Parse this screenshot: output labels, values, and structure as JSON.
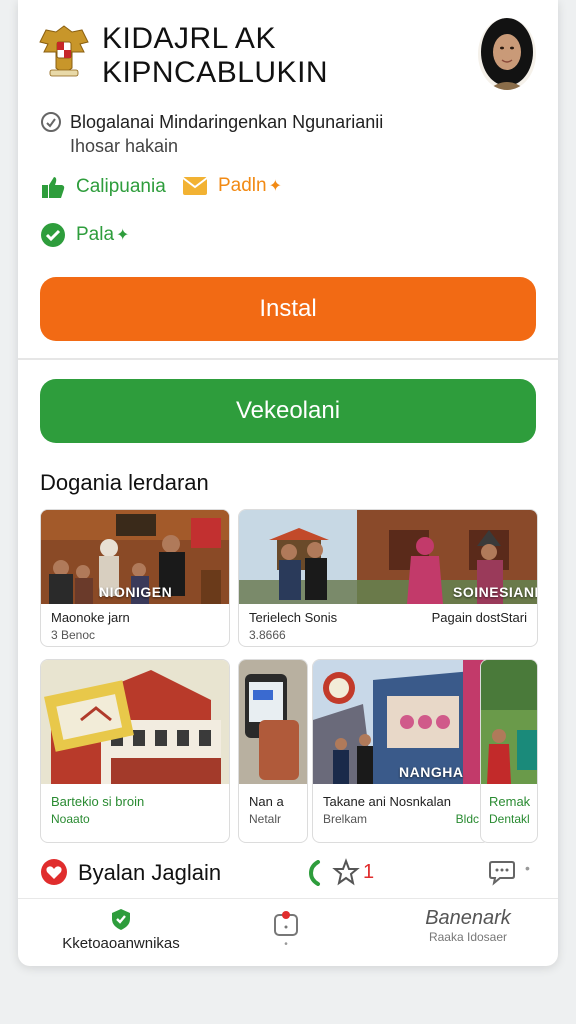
{
  "header": {
    "title_line1": "KIDAJRL AK",
    "title_line2": "KIPNCABLUKIN"
  },
  "description": {
    "line1": "Blogalanai Mindaringenkan Ngunarianii",
    "line2": "Ihosar hakain"
  },
  "tags": [
    {
      "label": "Calipuania",
      "icon": "thumbs-up-icon",
      "color": "#2e9d3c"
    },
    {
      "label": "Padln",
      "icon": "envelope-icon",
      "color": "#f28a14"
    },
    {
      "label": "Pala",
      "icon": "check-circle-icon",
      "color": "#2e9d3c"
    }
  ],
  "buttons": {
    "install": "Instal",
    "secondary": "Vekeolani"
  },
  "section": {
    "title": "Dogania lerdaran"
  },
  "tiles_row1": [
    {
      "overlay": "NIONIGEN",
      "caption": "Maonoke jarn",
      "sub": "3 Benoc"
    },
    {
      "overlay": "SOINESIANI",
      "caption": "Terielech Sonis",
      "caption_right": "Pagain dostStari",
      "sub": "3.8666"
    }
  ],
  "tiles_row2": [
    {
      "caption": "Bartekio si broin",
      "sub": "Noaato"
    },
    {
      "caption": "Nan a",
      "sub": "Netalr"
    },
    {
      "overlay": "NANGHA",
      "caption": "Takane ani Nosnkalan",
      "sub": "Brelkam",
      "sub_right": "Bldc"
    },
    {
      "caption": "Remak",
      "sub": "Dentakl"
    }
  ],
  "bottom": {
    "label": "Byalan Jaglain",
    "count": "1"
  },
  "nav": {
    "left": "Kketoaoanwnikas",
    "right": "Banenark",
    "right_sub": "Raaka Idosaer"
  },
  "colors": {
    "accent_orange": "#f26a14",
    "accent_green": "#2e9d3c",
    "alert_red": "#e02d2d"
  }
}
